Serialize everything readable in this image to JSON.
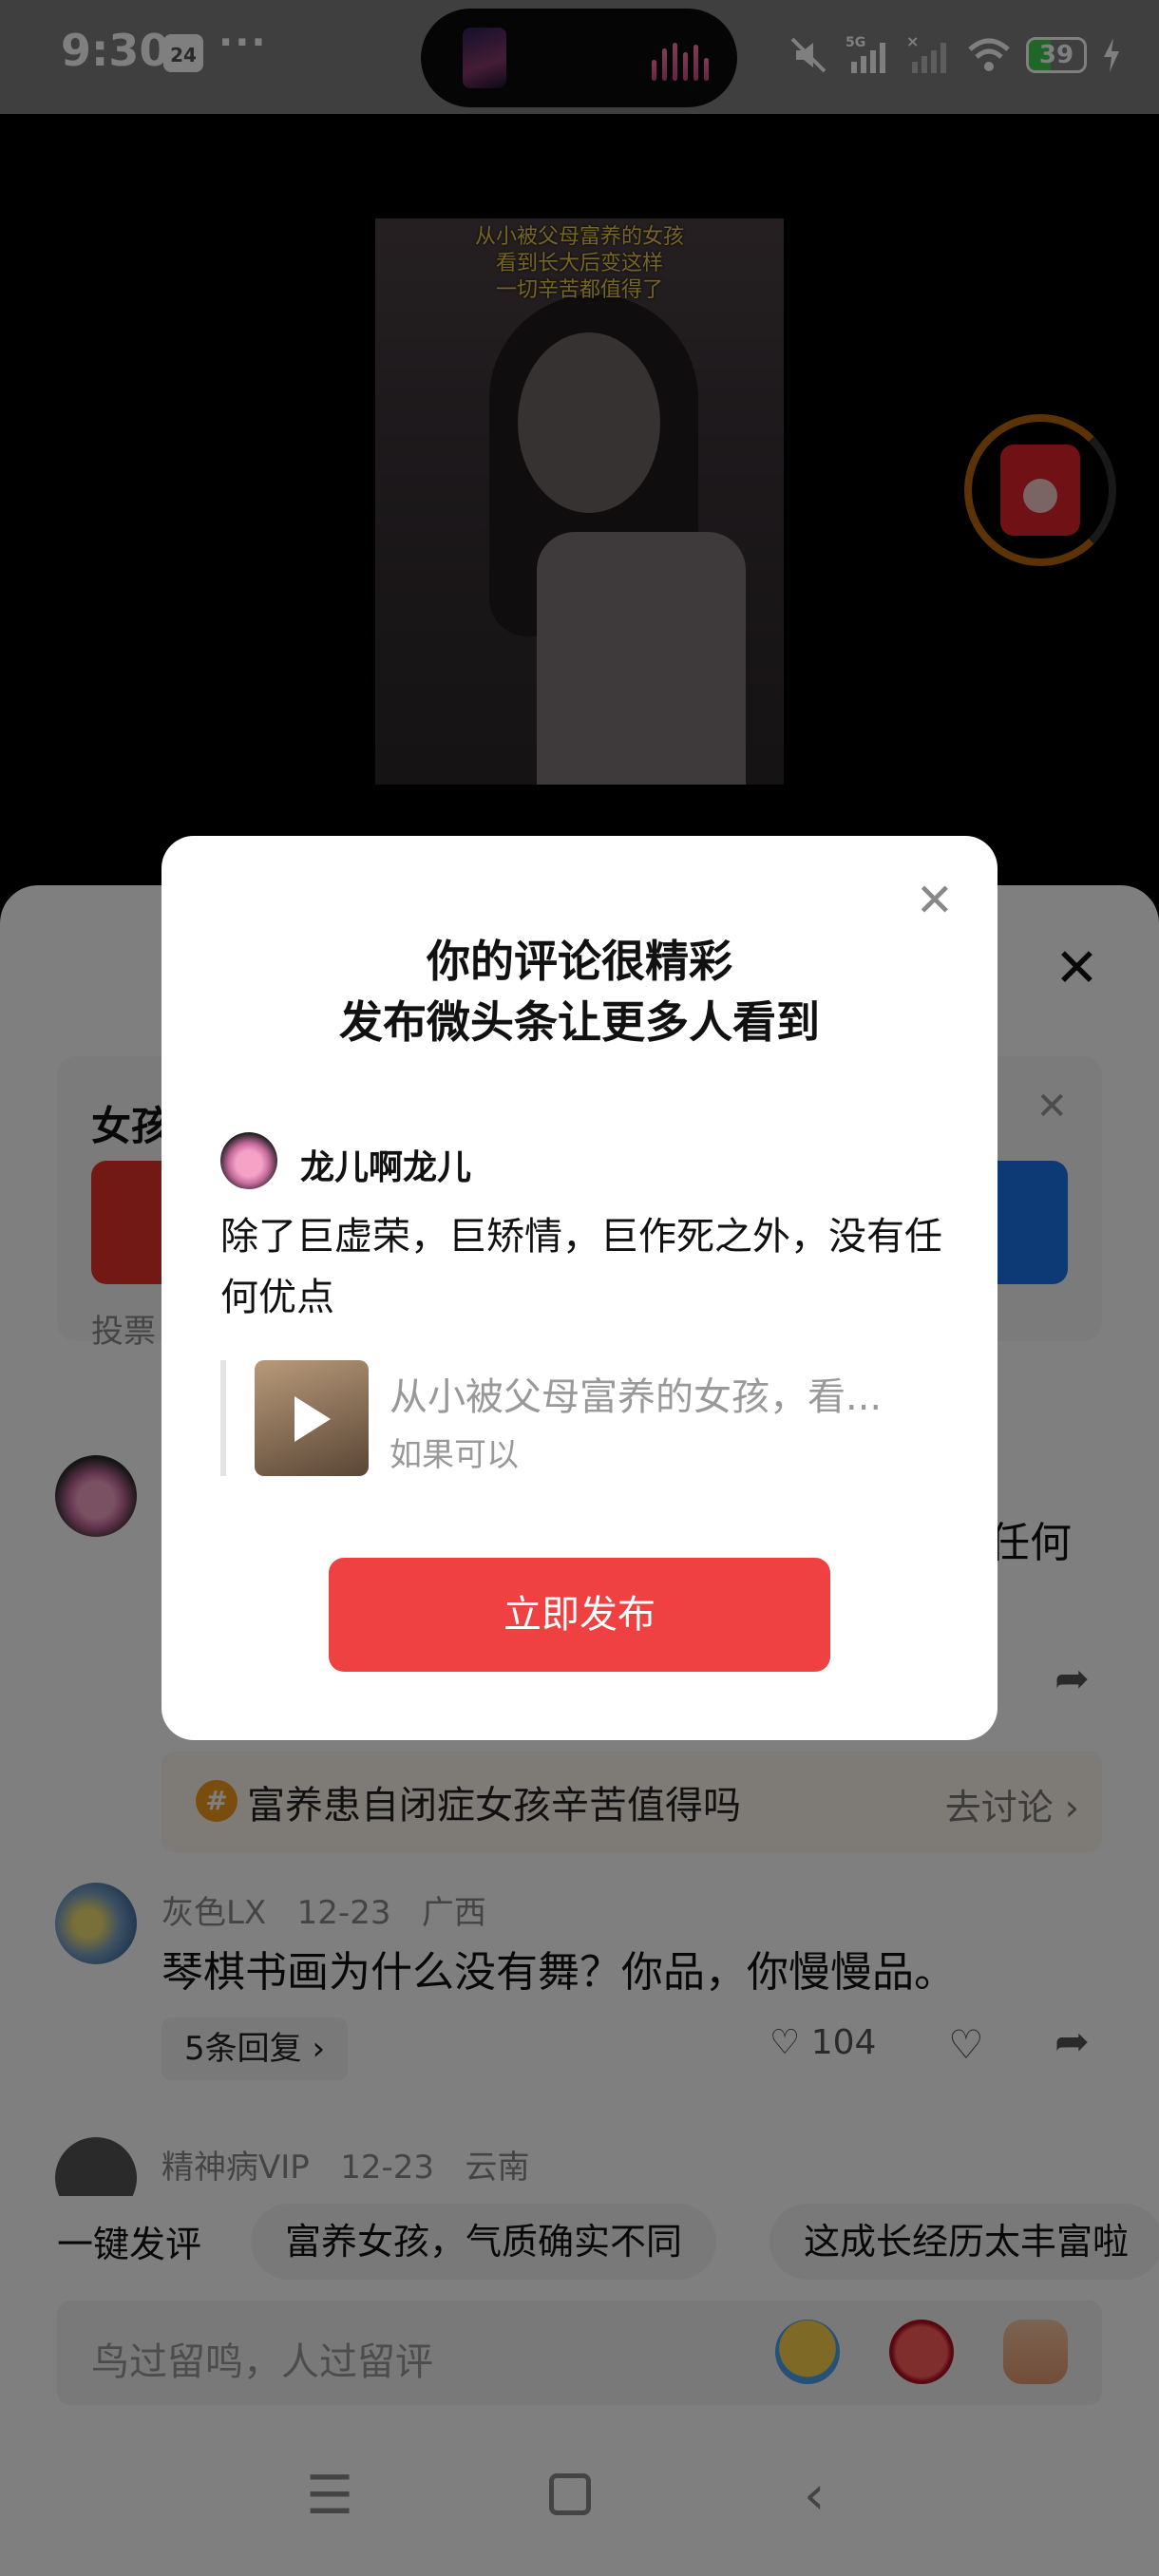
{
  "status_bar": {
    "time": "9:30",
    "calendar_day": "24",
    "network": "5G",
    "battery_percent": "39",
    "battery_level": 0.39
  },
  "video": {
    "caption_lines": [
      "从小被父母富养的女孩",
      "看到长大后变这样",
      "一切辛苦都值得了"
    ]
  },
  "sheet": {
    "vote_title": "女孩",
    "vote_label": "投票",
    "comment1_tail": "任何",
    "topic": {
      "icon": "#",
      "text": "富养患自闭症女孩辛苦值得吗",
      "action": "去讨论 ›"
    },
    "comment2": {
      "user": "灰色LX",
      "date": "12-23",
      "location": "广西",
      "text": "琴棋书画为什么没有舞？你品，你慢慢品。",
      "replies": "5条回复 ›",
      "likes": "104"
    },
    "comment3": {
      "user": "精神病VIP",
      "date": "12-23",
      "location": "云南"
    },
    "quick_label": "一键发评",
    "chips": [
      "富养女孩，气质确实不同",
      "这成长经历太丰富啦"
    ],
    "input_placeholder": "鸟过留鸣，人过留评"
  },
  "dialog": {
    "title_line1": "你的评论很精彩",
    "title_line2": "发布微头条让更多人看到",
    "username": "龙儿啊龙儿",
    "comment": "除了巨虚荣，巨矫情，巨作死之外，没有任何优点",
    "quote_title": "从小被父母富养的女孩，看...",
    "quote_sub": "如果可以",
    "button": "立即发布"
  }
}
